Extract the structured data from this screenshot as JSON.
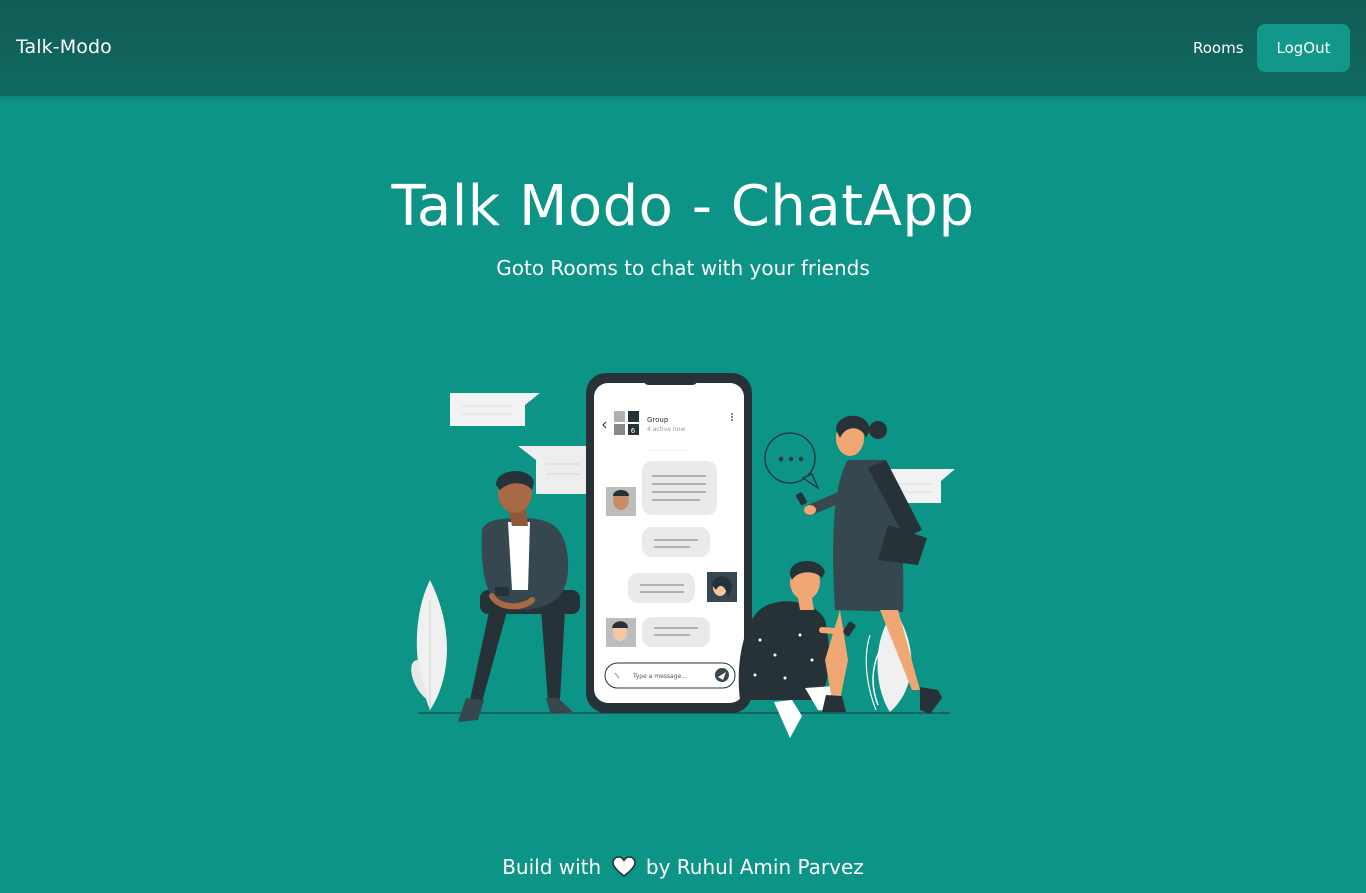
{
  "navbar": {
    "brand": "Talk-Modo",
    "rooms_label": "Rooms",
    "logout_label": "LogOut"
  },
  "hero": {
    "title": "Talk Modo - ChatApp",
    "subtitle": "Goto Rooms to chat with your friends"
  },
  "illustration": {
    "chat_group_name": "Group",
    "chat_group_status": "4 active now",
    "chat_member_count": "6",
    "message_placeholder": "Type a message..."
  },
  "footer": {
    "prefix": "Build with",
    "icon": "heart-icon",
    "suffix": "by Ruhul Amin Parvez"
  },
  "colors": {
    "background": "#0c9486",
    "navbar": "#115c55",
    "button": "#12988a",
    "text": "#ffffff"
  }
}
